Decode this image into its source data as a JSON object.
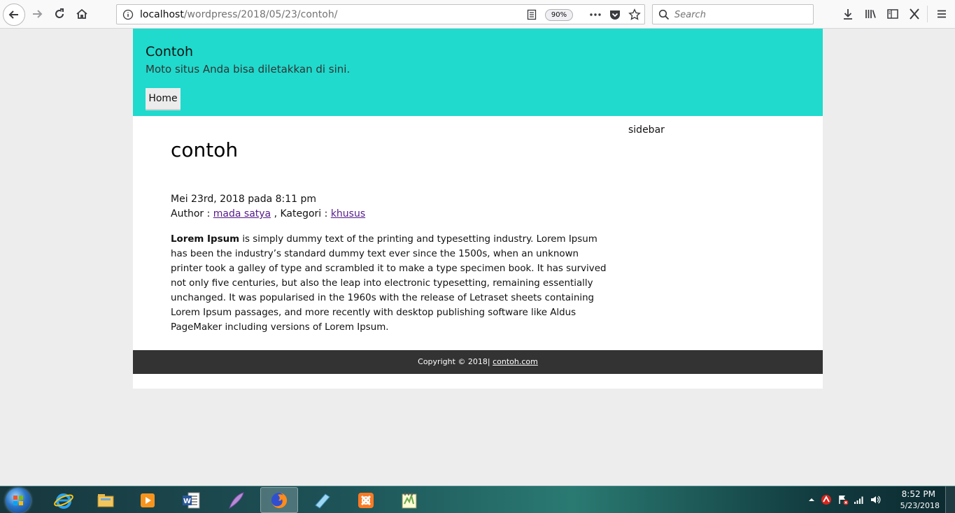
{
  "browser": {
    "url_host": "localhost",
    "url_path": "/wordpress/2018/05/23/contoh/",
    "zoom": "90%",
    "search_placeholder": "Search"
  },
  "site": {
    "title": "Contoh",
    "description": "Moto situs Anda bisa diletakkan di sini.",
    "nav": {
      "home": "Home"
    }
  },
  "post": {
    "title": "contoh",
    "date": "Mei 23rd, 2018 pada 8:11 pm",
    "author_label": "Author : ",
    "author": "mada satya",
    "category_label": " , Kategori : ",
    "category": "khusus",
    "lead": "Lorem Ipsum",
    "body": " is simply dummy text of the printing and typesetting industry. Lorem Ipsum has been the industry’s standard dummy text ever since the 1500s, when an unknown printer took a galley of type and scrambled it to make a type specimen book. It has survived not only five centuries, but also the leap into electronic typesetting, remaining essentially unchanged. It was popularised in the 1960s with the release of Letraset sheets containing Lorem Ipsum passages, and more recently with desktop publishing software like Aldus PageMaker including versions of Lorem Ipsum."
  },
  "sidebar": {
    "label": "sidebar"
  },
  "footer": {
    "copyright": "Copyright © 2018| ",
    "link": "contoh.com"
  },
  "taskbar": {
    "time": "8:52 PM",
    "date": "5/23/2018",
    "apps": [
      "internet-explorer",
      "file-explorer",
      "media-player",
      "word",
      "feather-app",
      "firefox",
      "notes-app",
      "xampp",
      "notepad-plus-plus"
    ]
  },
  "colors": {
    "header_bg": "#1fdacd",
    "footer_bg": "#333333",
    "link_visited": "#551a8b"
  }
}
